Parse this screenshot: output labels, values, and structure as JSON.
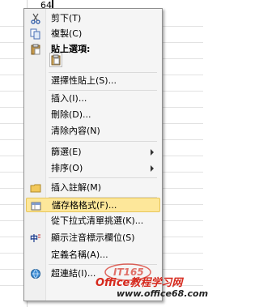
{
  "sheet": {
    "cell_value": "64"
  },
  "context_menu": {
    "items": [
      {
        "label": "剪下(T)",
        "icon": "scissors-icon"
      },
      {
        "label": "複製(C)",
        "icon": "copy-icon"
      },
      {
        "label": "貼上選項:",
        "icon": "clipboard-icon"
      },
      {
        "label": "選擇性貼上(S)...",
        "icon": ""
      },
      {
        "label": "插入(I)...",
        "icon": ""
      },
      {
        "label": "刪除(D)...",
        "icon": ""
      },
      {
        "label": "清除內容(N)",
        "icon": ""
      },
      {
        "label": "篩選(E)",
        "icon": "",
        "submenu": true
      },
      {
        "label": "排序(O)",
        "icon": "",
        "submenu": true
      },
      {
        "label": "插入註解(M)",
        "icon": "folder-icon"
      },
      {
        "label": "儲存格格式(F)...",
        "icon": "format-cells-icon",
        "highlighted": true
      },
      {
        "label": "從下拉式清單挑選(K)...",
        "icon": ""
      },
      {
        "label": "顯示注音標示欄位(S)",
        "icon": "phonetic-icon"
      },
      {
        "label": "定義名稱(A)...",
        "icon": ""
      },
      {
        "label": "超連結(I)...",
        "icon": "hyperlink-icon"
      }
    ]
  },
  "watermark": {
    "brand": "IT165",
    "main": "Office教程学习网",
    "url": "www.office68.com"
  }
}
